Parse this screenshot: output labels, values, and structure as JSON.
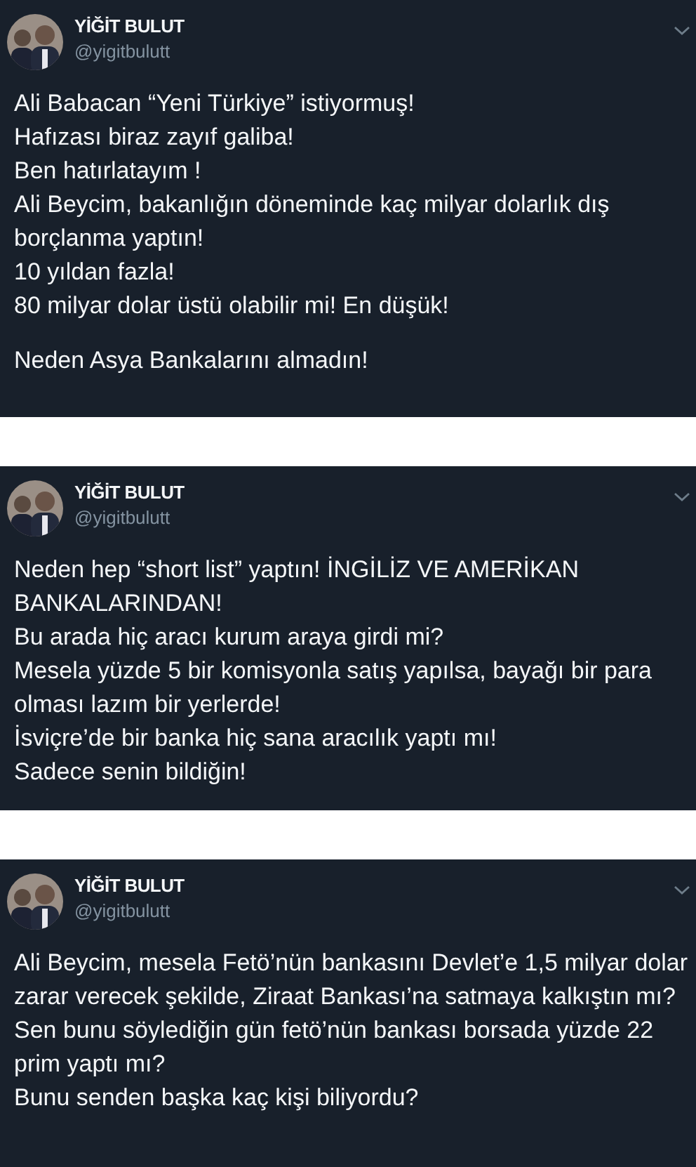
{
  "tweets": [
    {
      "author": {
        "name": "YİĞİT BULUT",
        "handle": "@yigitbulutt"
      },
      "paragraphs": [
        [
          "Ali Babacan “Yeni Türkiye” istiyormuş!",
          "Hafızası biraz zayıf galiba!",
          "Ben hatırlatayım !",
          "Ali Beycim, bakanlığın döneminde kaç milyar dolarlık dış borçlanma yaptın!",
          "10 yıldan fazla!",
          "80 milyar dolar üstü olabilir mi! En düşük!"
        ],
        [
          "Neden Asya Bankalarını almadın!"
        ]
      ]
    },
    {
      "author": {
        "name": "YİĞİT BULUT",
        "handle": "@yigitbulutt"
      },
      "paragraphs": [
        [
          "Neden hep “short list” yaptın! İNGİLİZ VE AMERİKAN BANKALARINDAN!",
          "Bu arada hiç aracı kurum araya girdi mi?",
          "Mesela yüzde 5 bir komisyonla satış yapılsa, bayağı bir para olması lazım bir yerlerde!",
          "İsviçre’de bir banka hiç sana aracılık yaptı mı!",
          "Sadece senin bildiğin!"
        ]
      ]
    },
    {
      "author": {
        "name": "YİĞİT BULUT",
        "handle": "@yigitbulutt"
      },
      "paragraphs": [
        [
          "Ali Beycim, mesela Fetö’nün bankasını Devlet’e 1,5 milyar dolar zarar verecek şekilde, Ziraat Bankası’na satmaya kalkıştın mı?",
          "Sen bunu söylediğin gün fetö’nün bankası borsada yüzde 22 prim yaptı mı?",
          "Bunu senden başka kaç kişi biliyordu?"
        ]
      ]
    }
  ]
}
